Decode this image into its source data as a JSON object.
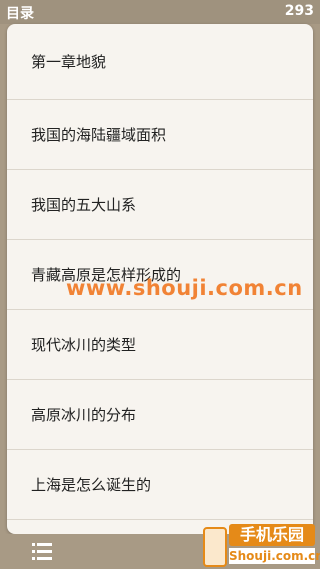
{
  "header": {
    "title": "目录",
    "count": "293"
  },
  "toc": {
    "items": [
      "第一章地貌",
      "我国的海陆疆域面积",
      "我国的五大山系",
      "青藏高原是怎样形成的",
      "现代冰川的类型",
      "高原冰川的分布",
      "上海是怎么诞生的"
    ]
  },
  "footer": {
    "menu_icon": "list-menu-icon"
  },
  "watermark": {
    "text": "www.shouji.com.cn"
  },
  "logo": {
    "cn": "手机乐园",
    "url": "Shouji.com.cn"
  },
  "colors": {
    "background": "#a89a85",
    "panel": "#f7f4ef",
    "accent": "#e58a18"
  }
}
